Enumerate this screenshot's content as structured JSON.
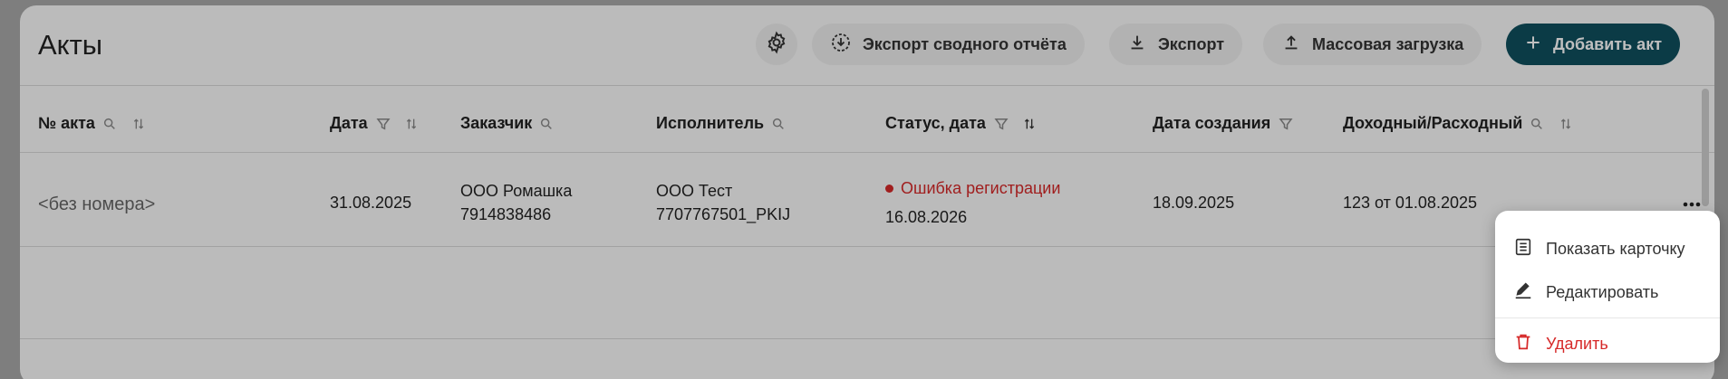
{
  "page": {
    "title": "Акты"
  },
  "toolbar": {
    "settings_icon": "gear-icon",
    "export_summary_label": "Экспорт сводного отчёта",
    "export_label": "Экспорт",
    "bulk_upload_label": "Массовая загрузка",
    "add_act_label": "Добавить акт"
  },
  "table": {
    "columns": [
      {
        "label": "№ акта",
        "search": true,
        "filter": false,
        "sort": true
      },
      {
        "label": "Дата",
        "search": false,
        "filter": true,
        "sort": true
      },
      {
        "label": "Заказчик",
        "search": true,
        "filter": false,
        "sort": false
      },
      {
        "label": "Исполнитель",
        "search": true,
        "filter": false,
        "sort": false
      },
      {
        "label": "Статус, дата",
        "search": false,
        "filter": true,
        "sort": true
      },
      {
        "label": "Дата создания",
        "search": false,
        "filter": true,
        "sort": false
      },
      {
        "label": "Доходный/Расходный",
        "search": true,
        "filter": false,
        "sort": true
      }
    ],
    "rows": [
      {
        "number": "<без номера>",
        "date": "31.08.2025",
        "customer_name": "ООО Ромашка",
        "customer_inn": "7914838486",
        "executor_name": "ООО Тест",
        "executor_inn": "7707767501_PKIJ",
        "status": "Ошибка регистрации",
        "status_date": "16.08.2026",
        "created": "18.09.2025",
        "income_expense": "123 от 01.08.2025",
        "actions_icon": "more-horizontal-icon"
      }
    ]
  },
  "context_menu": {
    "items": [
      {
        "label": "Показать карточку",
        "icon": "card-list-icon"
      },
      {
        "label": "Редактировать",
        "icon": "pencil-icon"
      },
      {
        "label": "Удалить",
        "icon": "trash-icon"
      }
    ]
  },
  "colors": {
    "primary": "#0f4f5e",
    "danger": "#d62828",
    "overlay": "rgba(0,0,0,0.25)"
  }
}
